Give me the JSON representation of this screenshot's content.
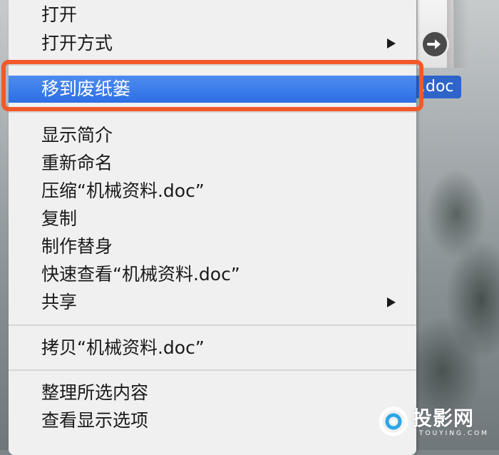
{
  "desktop": {
    "file_name_label": ".doc"
  },
  "context_menu": {
    "items": [
      {
        "label": "打开"
      },
      {
        "label": "打开方式"
      },
      {
        "label": "移到废纸篓",
        "highlighted": true
      },
      {
        "label": "显示简介"
      },
      {
        "label": "重新命名"
      },
      {
        "label": "压缩“机械资料.doc”"
      },
      {
        "label": "复制"
      },
      {
        "label": "制作替身"
      },
      {
        "label": "快速查看“机械资料.doc”"
      },
      {
        "label": "共享"
      },
      {
        "label": "拷贝“机械资料.doc”"
      },
      {
        "label": "整理所选内容"
      },
      {
        "label": "查看显示选项"
      }
    ]
  },
  "watermark": {
    "brand_text": "投影网",
    "sub_text": "TOUYING.COM"
  },
  "colors": {
    "highlight_blue": "#2d6fe4",
    "annotation_orange": "#f2592a"
  }
}
